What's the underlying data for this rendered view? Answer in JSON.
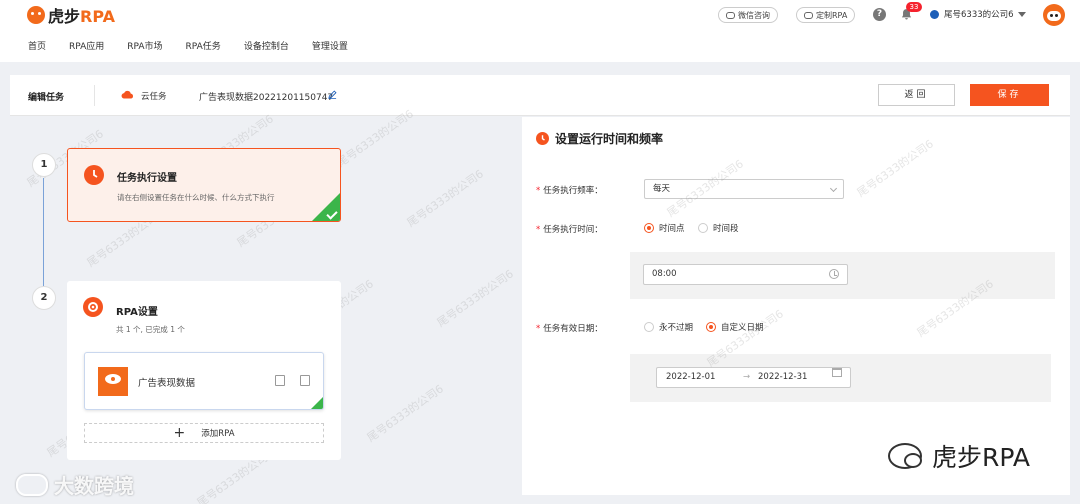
{
  "brand": {
    "logo_text_cn": "虎步",
    "logo_text_en": "RPA"
  },
  "nav": [
    "首页",
    "RPA应用",
    "RPA市场",
    "RPA任务",
    "设备控制台",
    "管理设置"
  ],
  "header": {
    "wechat_label": "微信咨询",
    "custom_label": "定制RPA",
    "help_label": "?",
    "notification_count": "33",
    "company_label": "尾号6333的公司6"
  },
  "subbar": {
    "title": "编辑任务",
    "cloud_label": "云任务",
    "task_name": "广告表现数据20221201150747",
    "back_label": "返回",
    "save_label": "保存"
  },
  "steps": [
    {
      "number": "1",
      "title": "任务执行设置",
      "desc": "请在右侧设置任务在什么时候、什么方式下执行"
    },
    {
      "number": "2",
      "title": "RPA设置",
      "desc": "共 1 个, 已完成 1 个"
    }
  ],
  "rpa_item": {
    "name": "广告表现数据",
    "add_label": "添加RPA"
  },
  "right_panel": {
    "title": "设置运行时间和频率",
    "freq_label": "任务执行频率：",
    "freq_value": "每天",
    "time_label": "任务执行时间：",
    "time_opt1": "时间点",
    "time_opt2": "时间段",
    "time_value": "08:00",
    "valid_label": "任务有效日期：",
    "valid_opt1": "永不过期",
    "valid_opt2": "自定义日期",
    "start_date": "2022-12-01",
    "range_sep": "→",
    "end_date": "2022-12-31"
  },
  "watermarks": {
    "user": "尾号6333的公司6",
    "brand_bottom": "虎步RPA",
    "dsk": "大数跨境"
  },
  "colors": {
    "accent": "#f5541f",
    "success": "#3bb54a",
    "link_blue": "#1e5fb8"
  }
}
